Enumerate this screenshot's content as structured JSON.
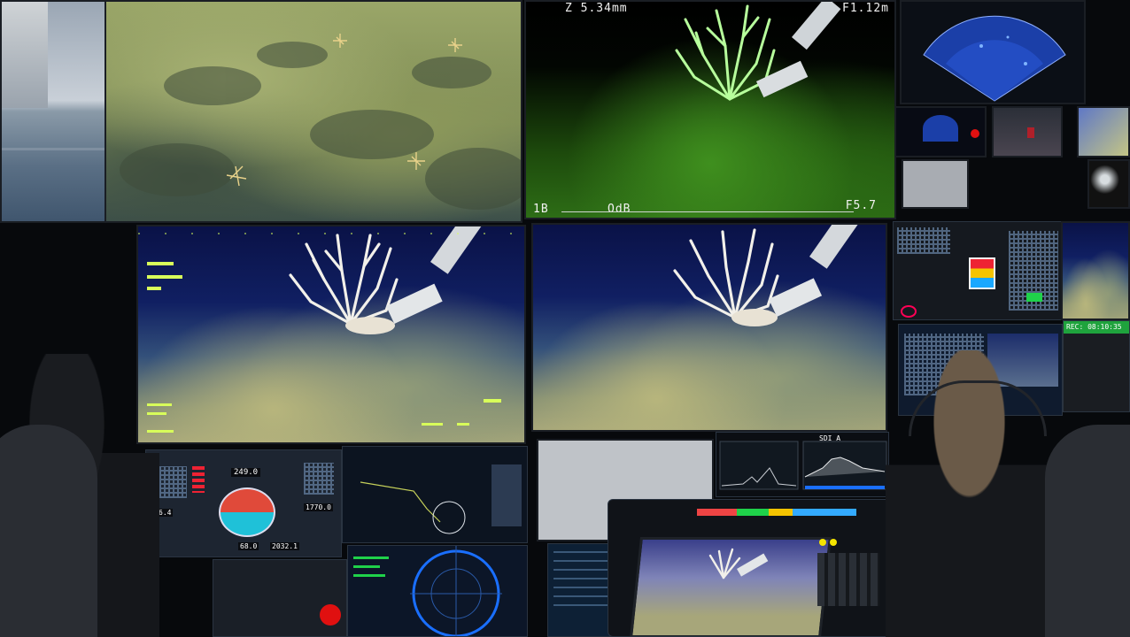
{
  "camera_top_center": {
    "hud_top_left": "Z 5.34mm",
    "hud_top_right": "F1.12m",
    "hud_bottom_left": "1B",
    "hud_bottom_center": "OdB",
    "hud_bottom_right": "F5.7"
  },
  "right_console": {
    "rec_label": "REC: 08:10:35"
  },
  "center_monitor": {
    "panel_title": "SDI A"
  },
  "lower_left_console": {
    "readout_1": "249.0",
    "readout_2": "1770.0",
    "readout_3": "6.4",
    "readout_4": "68.0",
    "readout_5": "2032.1"
  },
  "colors": {
    "background": "#07090c",
    "hud_text": "#f2f2f2",
    "accent_red": "#e01010",
    "accent_green": "#1fd24a"
  }
}
